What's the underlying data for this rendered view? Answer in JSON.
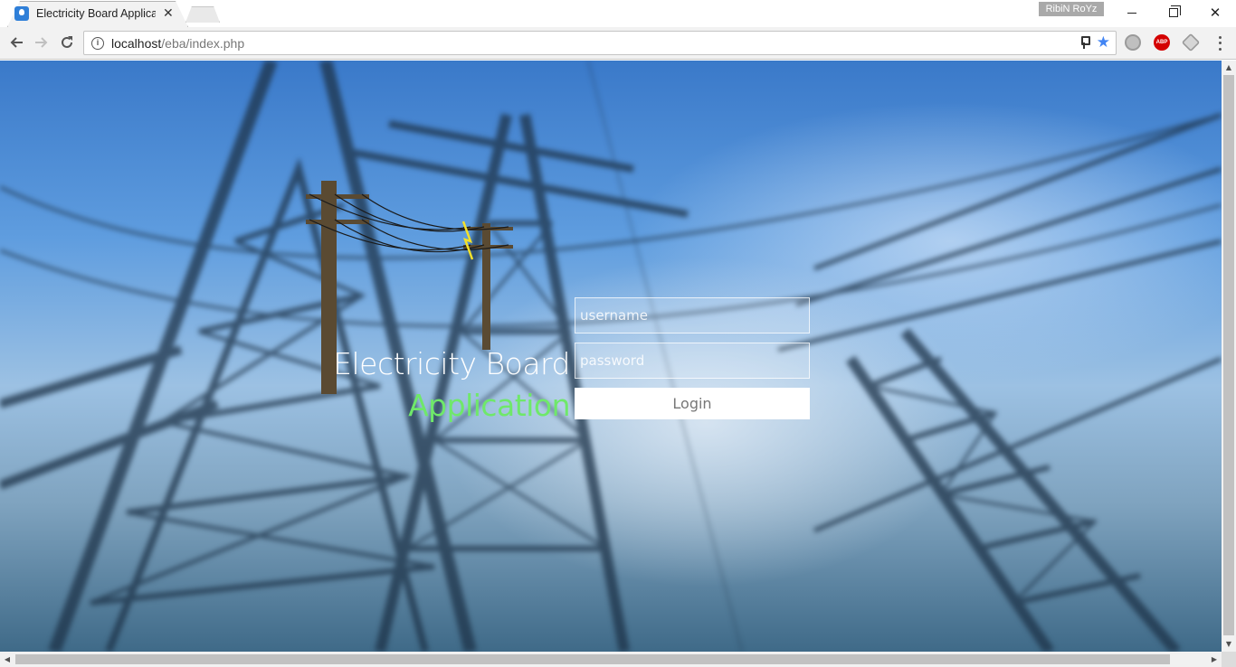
{
  "browser": {
    "tab_title": "Electricity Board Applicat",
    "profile_name": "RibiN RoYz",
    "url_host": "localhost",
    "url_path": "/eba/index.php",
    "extensions": [
      "globe-icon",
      "adblock-plus-icon",
      "cube-icon"
    ],
    "abp_label": "ABP"
  },
  "page": {
    "title_line1": "Electricity Board",
    "title_line2": "Application",
    "title_accent_color": "#6fe86a",
    "username_placeholder": "username",
    "password_placeholder": "password",
    "login_label": "Login"
  }
}
